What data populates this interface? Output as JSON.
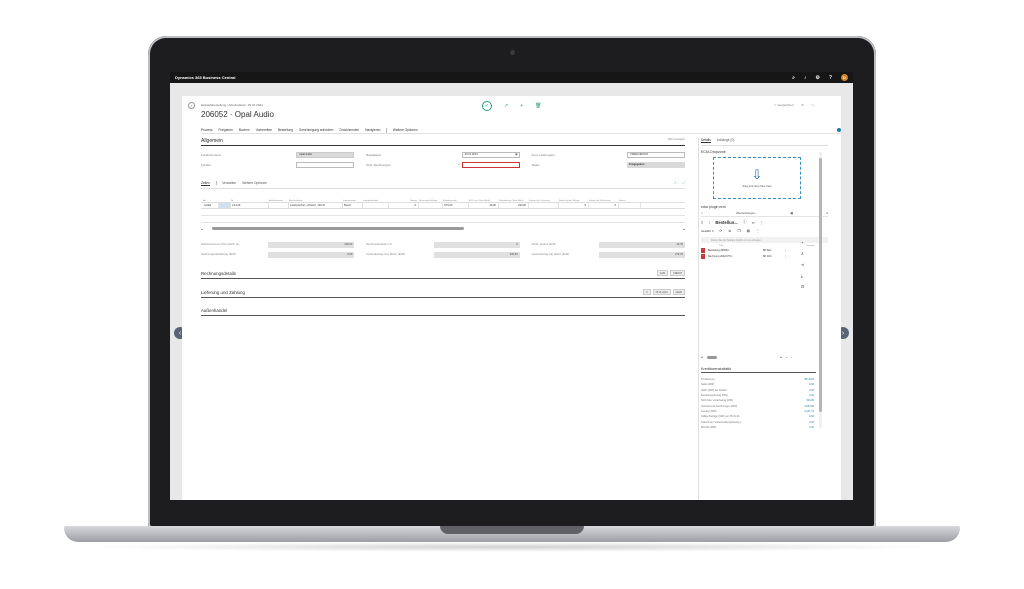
{
  "appbar": {
    "title": "Dynamics 365 Business Central",
    "avatar_initial": "D",
    "icons": [
      "search-icon",
      "bell-icon",
      "gear-icon",
      "help-icon"
    ]
  },
  "header": {
    "breadcrumb": "Einkaufsbestellung | Arbeitsdatum: 25.01.2024",
    "title": "206052 · Opal Audio",
    "saved_label": "✓ Gespeichert"
  },
  "actions": [
    "Prozess",
    "Freigeben",
    "Buchen",
    "Vorbereiten",
    "Bestellung",
    "Genehmigung anfordern",
    "Druck/senden",
    "Navigieren",
    "Weitere Optionen"
  ],
  "general": {
    "title": "Allgemein",
    "more_label": "Mehr anzeigen",
    "fields": [
      {
        "label": "Kreditorenname",
        "value": "Opal Audio",
        "style": "grey"
      },
      {
        "label": "Belegdatum",
        "value": "25.01.2024",
        "style": "date"
      },
      {
        "label": "Kred.-Lieferungsnr.",
        "value": "KREDLNR0107",
        "style": "input"
      },
      {
        "label": "Kontakt",
        "value": "",
        "style": "input"
      },
      {
        "label": "Kred.-Rechnungsnr.",
        "value": "",
        "style": "req"
      },
      {
        "label": "Status",
        "value": "Freigegeben",
        "style": "plain"
      }
    ]
  },
  "lines": {
    "tabs": [
      "Zeilen",
      "Verwalten",
      "Weitere Optionen"
    ],
    "columns": [
      "Art",
      "",
      "Nr.",
      "Artikelreferenz",
      "Beschreibung",
      "Lagerortcode",
      "Lagerplatzcode",
      "Menge",
      "Reservierte Menge",
      "Einheitencode",
      "EK-Preis Ohne MwSt.",
      "Zeilenbetrag Ohne MwSt.",
      "Menge akt. Lieferung",
      "Bereits gelief. Menge",
      "Menge akt. Rechnung",
      "Bereits"
    ],
    "rows": [
      {
        "art": "Artikel",
        "nr": "LS-120",
        "ref": "",
        "desc": "Lautsprecher, schwarz, 120 W",
        "loc": "BLAU",
        "bin": "",
        "qty": "5",
        "res": "",
        "uom": "STÜCK",
        "price": "46,00",
        "amount": "230,00",
        "recv": "",
        "recvd": "5",
        "inv": "5",
        "invd": ""
      }
    ]
  },
  "totals": [
    {
      "label": "Zwischensumme Ohne MwSt. (E...",
      "value": "230,00"
    },
    {
      "label": "Rechnungsrabatt in %",
      "value": "0"
    },
    {
      "label": "MwSt. gesamt (EUR)",
      "value": "43,70"
    },
    {
      "label": "Rechnungsrabattbetrag (EUR)",
      "value": "0,00"
    },
    {
      "label": "Gesamtbetrag ohne MwSt. (EUR)",
      "value": "230,00"
    },
    {
      "label": "Gesamtbetrag inkl. MwSt. (EUR)",
      "value": "273,70"
    }
  ],
  "sections": [
    {
      "title": "Rechnungsdetails",
      "chips": [
        "EUR",
        "KREDIT"
      ]
    },
    {
      "title": "Lieferung und Zahlung",
      "chips": [
        "0",
        "25.01.2024",
        "GELB"
      ]
    },
    {
      "title": "Außenhandel",
      "chips": []
    }
  ],
  "factbox": {
    "tabs": [
      "Details",
      "Anhänge (0)"
    ],
    "ecm_title": "ECM-Dropzone",
    "drop_text": "drag and drop files here",
    "plugin_title": "edoc plugin ecm",
    "breadcrumb": "Übersetzungen...",
    "folder": "Bestellun...",
    "selected": "Gewählt: 0",
    "search_placeholder": "Ziehen Sie die Spalten hierhin um sie anzeigen...",
    "file_headers": [
      "Titel",
      "Kategor..."
    ],
    "files": [
      {
        "title": "Bestellung 206052",
        "cat": "BK Bes"
      },
      {
        "title": "Rechnung 2022-KTN...",
        "cat": "BK Rch"
      }
    ],
    "stats_title": "Kreditorenstatistik",
    "stats": [
      {
        "label": "Kreditorennr.",
        "value": "BK-3011"
      },
      {
        "label": "Saldo (MW)",
        "value": "0,00"
      },
      {
        "label": "Saldo (MW) als Debitor",
        "value": "0,00"
      },
      {
        "label": "Bestellungsbetrag (MW)",
        "value": "0,00"
      },
      {
        "label": "Nicht fakt. Lieferbetrag (MW)",
        "value": "364,80"
      },
      {
        "label": "Ausstehende Rechnungen (MW)",
        "value": "3.832,80"
      },
      {
        "label": "Gesamt (MW)",
        "value": "4.447,74"
      },
      {
        "label": "Fällige Beträge (MW) per 25.01.24",
        "value": "0,00"
      },
      {
        "label": "Fakturierter Vorauszahlungsbetrag (...",
        "value": "0,00"
      },
      {
        "label": "Bezahlt (MW)",
        "value": "0,00"
      }
    ]
  }
}
